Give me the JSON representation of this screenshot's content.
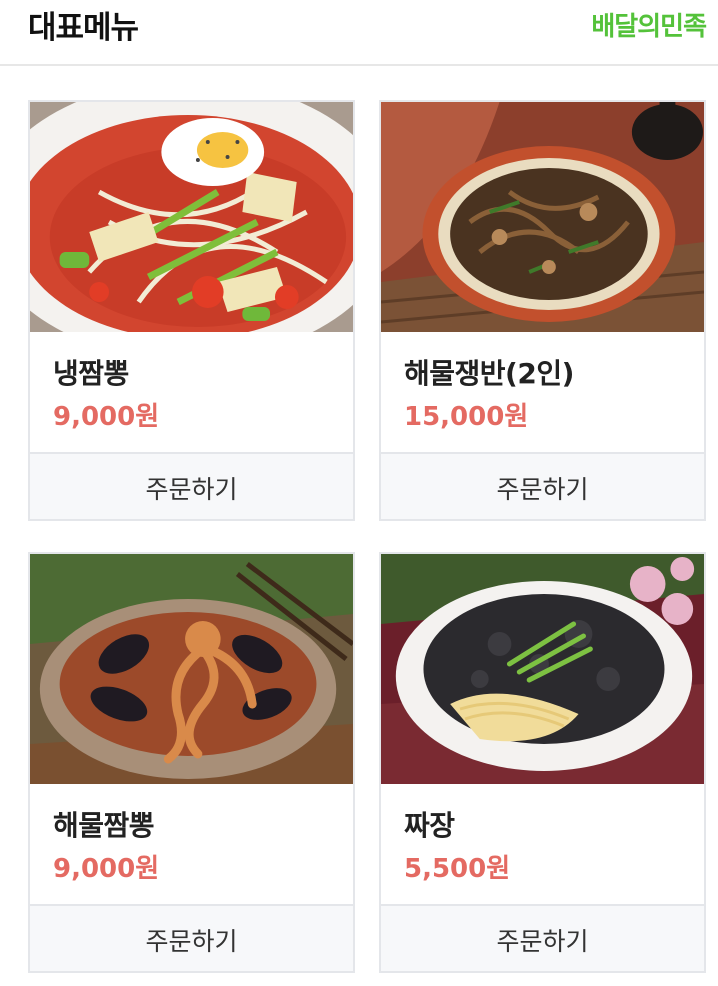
{
  "header": {
    "title": "대표메뉴",
    "brand": "배달의민족"
  },
  "colors": {
    "brand": "#54c23a",
    "price": "#e46a62",
    "border": "#e4e6ea",
    "button_bg": "#f7f8fa"
  },
  "menu": [
    {
      "name": "냉짬뽕",
      "price": "9,000원",
      "order_label": "주문하기",
      "photo_icon": "cold-jjamppong-photo"
    },
    {
      "name": "해물쟁반(2인)",
      "price": "15,000원",
      "order_label": "주문하기",
      "photo_icon": "seafood-jaengban-photo"
    },
    {
      "name": "해물짬뽕",
      "price": "9,000원",
      "order_label": "주문하기",
      "photo_icon": "seafood-jjamppong-photo"
    },
    {
      "name": "짜장",
      "price": "5,500원",
      "order_label": "주문하기",
      "photo_icon": "jajangmyeon-photo"
    }
  ]
}
